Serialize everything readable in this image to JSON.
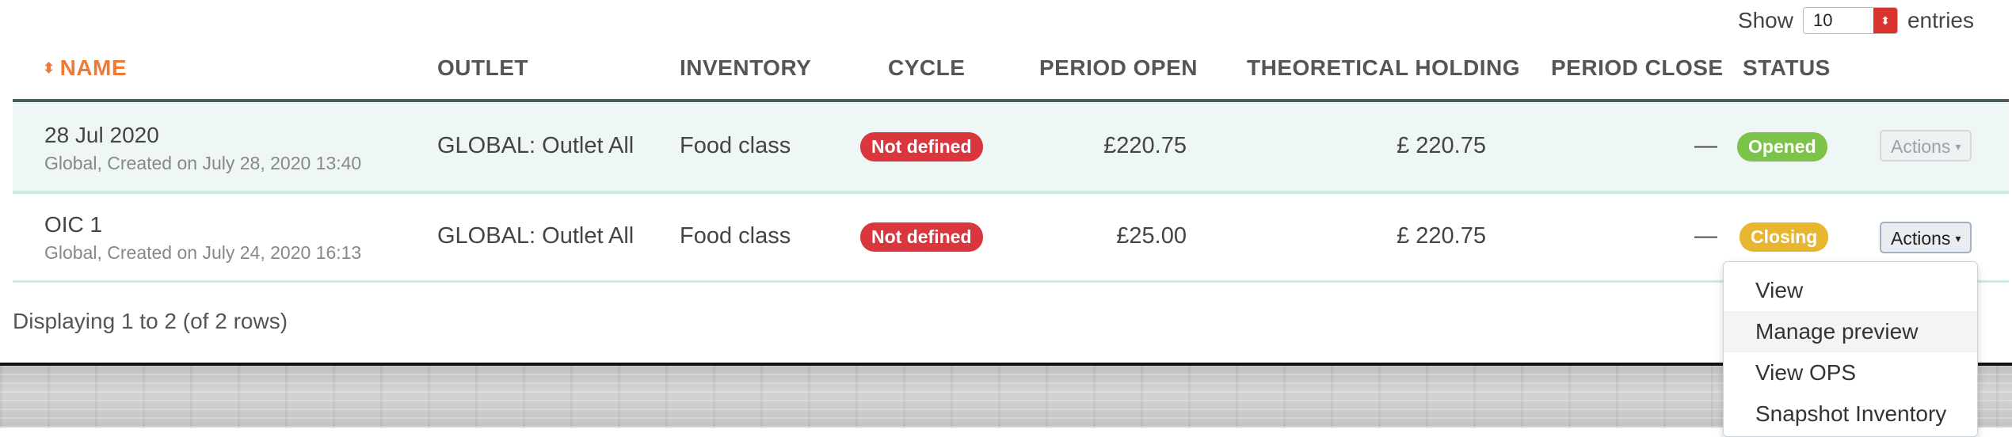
{
  "show_entries": {
    "prefix": "Show",
    "value": "10",
    "suffix": "entries",
    "spinner_glyph": "⬍"
  },
  "table": {
    "sort_icon": "⬍",
    "columns": {
      "name": "NAME",
      "outlet": "OUTLET",
      "inventory": "INVENTORY",
      "cycle": "CYCLE",
      "period_open": "PERIOD OPEN",
      "theoretical_holding": "THEORETICAL HOLDING",
      "period_close": "PERIOD CLOSE",
      "status": "STATUS"
    },
    "rows": [
      {
        "name": "28 Jul 2020",
        "sub": "Global, Created on July 28, 2020 13:40",
        "outlet": "GLOBAL: Outlet All",
        "inventory": "Food class",
        "cycle": "Not defined",
        "period_open": "£220.75",
        "theoretical_holding": "£ 220.75",
        "period_close": "—",
        "status": "Opened",
        "status_color": "#7cc34a",
        "actions": "Actions"
      },
      {
        "name": "OIC 1",
        "sub": "Global, Created on July 24, 2020 16:13",
        "outlet": "GLOBAL: Outlet All",
        "inventory": "Food class",
        "cycle": "Not defined",
        "period_open": "£25.00",
        "theoretical_holding": "£ 220.75",
        "period_close": "—",
        "status": "Closing",
        "status_color": "#e7b62e",
        "actions": "Actions"
      }
    ],
    "caret": "▾"
  },
  "footer": {
    "info": "Displaying 1 to 2 (of 2 rows)"
  },
  "actions_menu": {
    "items": [
      "View",
      "Manage preview",
      "View OPS",
      "Snapshot Inventory"
    ]
  },
  "colors": {
    "accent_orange": "#f07a33",
    "danger": "#d9363e",
    "row_highlight": "#eef7f5"
  }
}
